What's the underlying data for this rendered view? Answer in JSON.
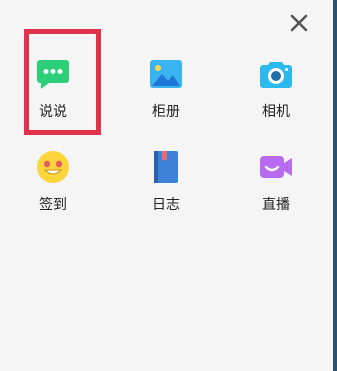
{
  "share_menu": {
    "row1": [
      {
        "label": "说说",
        "icon": "chat-bubble-icon"
      },
      {
        "label": "柜册",
        "icon": "photo-album-icon"
      },
      {
        "label": "相机",
        "icon": "camera-icon"
      }
    ],
    "row2": [
      {
        "label": "签到",
        "icon": "smiley-face-icon"
      },
      {
        "label": "日志",
        "icon": "diary-book-icon"
      },
      {
        "label": "直播",
        "icon": "live-video-icon"
      }
    ]
  },
  "colors": {
    "shuoshuo": "#2ccf78",
    "album": "#3ab4f0",
    "camera": "#2bb9ee",
    "signin": "#fcd53a",
    "diary": "#3d82d8",
    "live": "#b86bf0",
    "highlight": "#e0334b"
  }
}
